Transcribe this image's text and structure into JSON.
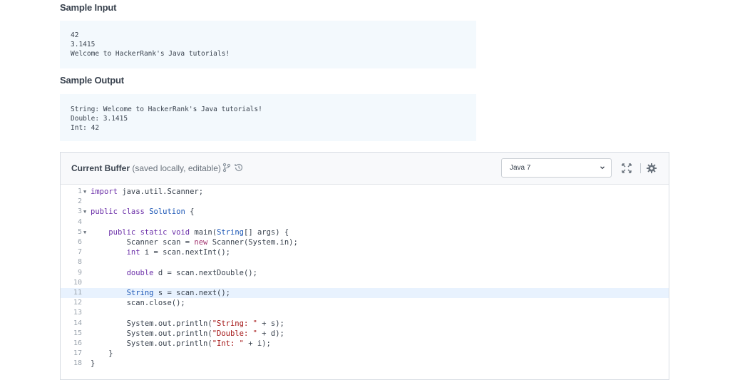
{
  "sample_input": {
    "title": "Sample Input",
    "lines": [
      "42",
      "3.1415",
      "Welcome to HackerRank's Java tutorials!"
    ]
  },
  "sample_output": {
    "title": "Sample Output",
    "lines": [
      "String: Welcome to HackerRank's Java tutorials!",
      "Double: 3.1415",
      "Int: 42"
    ]
  },
  "editor": {
    "buffer_title": "Current Buffer",
    "buffer_subtitle": "(saved locally, editable)",
    "language": "Java 7",
    "icons": [
      "branch-icon",
      "history-icon",
      "chevron-down-icon",
      "fullscreen-icon",
      "gear-icon"
    ],
    "active_line": 11,
    "line_numbers": [
      "1",
      "2",
      "3",
      "4",
      "5",
      "6",
      "7",
      "8",
      "9",
      "10",
      "11",
      "12",
      "13",
      "14",
      "15",
      "16",
      "17",
      "18"
    ],
    "code": [
      "import java.util.Scanner;",
      "",
      "public class Solution {",
      "",
      "    public static void main(String[] args) {",
      "        Scanner scan = new Scanner(System.in);",
      "        int i = scan.nextInt();",
      "",
      "        double d = scan.nextDouble();",
      "",
      "        String s = scan.next();",
      "        scan.close();",
      "",
      "        System.out.println(\"String: \" + s);",
      "        System.out.println(\"Double: \" + d);",
      "        System.out.println(\"Int: \" + i);",
      "    }",
      "}"
    ]
  }
}
